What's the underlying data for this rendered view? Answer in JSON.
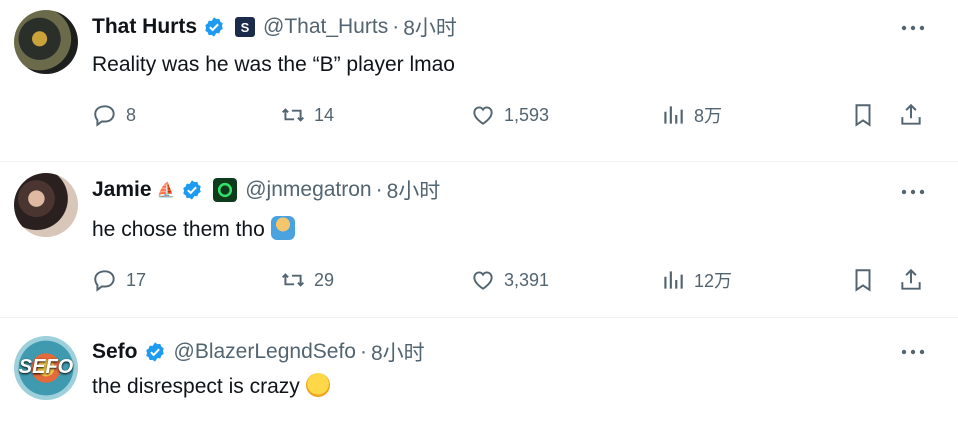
{
  "tweets": [
    {
      "display_name": "That Hurts",
      "handle": "@That_Hurts",
      "time": "8小时",
      "text": "Reality was he was the “B” player lmao",
      "counts": {
        "replies": "8",
        "retweets": "14",
        "likes": "1,593",
        "views": "8万"
      }
    },
    {
      "display_name": "Jamie",
      "handle": "@jnmegatron",
      "time": "8小时",
      "text": "he chose them tho",
      "counts": {
        "replies": "17",
        "retweets": "29",
        "likes": "3,391",
        "views": "12万"
      }
    },
    {
      "display_name": "Sefo",
      "handle": "@BlazerLegndSefo",
      "time": "8小时",
      "text": "the disrespect is crazy",
      "avatar_text": "SEFO"
    }
  ],
  "separator": "·",
  "colors": {
    "verified": "#1d9bf0",
    "muted": "#536471",
    "text": "#0f1419"
  }
}
